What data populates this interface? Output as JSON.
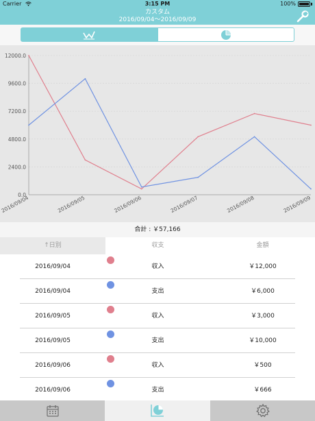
{
  "status_bar": {
    "carrier": "Carrier",
    "time": "3:15 PM",
    "battery": "100%"
  },
  "nav": {
    "title": "カスタム",
    "period": "2016/09/04～2016/09/09"
  },
  "segments": [
    {
      "name": "line-chart",
      "icon": "line-chart-icon",
      "selected": true
    },
    {
      "name": "pie-chart",
      "icon": "pie-chart-icon",
      "selected": false
    }
  ],
  "chart_data": {
    "type": "line",
    "categories": [
      "2016/09/04",
      "2016/09/05",
      "2016/09/06",
      "2016/09/07",
      "2016/09/08",
      "2016/09/09"
    ],
    "series": [
      {
        "values": [
          12000,
          3000,
          500,
          5000,
          7000,
          6000
        ],
        "color": "#e07f8d"
      },
      {
        "values": [
          6000,
          10000,
          666,
          1500,
          5000,
          500
        ],
        "color": "#6f92e2"
      }
    ],
    "y_ticks": [
      "0.0",
      "2400.0",
      "4800.0",
      "7200.0",
      "9600.0",
      "12000.0"
    ],
    "ylim": [
      0,
      12000
    ],
    "grid": true
  },
  "summary": {
    "total_label": "合計 : ￥57,166"
  },
  "table": {
    "headers": {
      "date": "↑日別",
      "type": "収支",
      "amount": "金額"
    },
    "rows": [
      {
        "date": "2016/09/04",
        "type": "収入",
        "amount": "￥12,000",
        "dot": "#e07f8d"
      },
      {
        "date": "2016/09/04",
        "type": "支出",
        "amount": "￥6,000",
        "dot": "#6f92e2"
      },
      {
        "date": "2016/09/05",
        "type": "収入",
        "amount": "￥3,000",
        "dot": "#e07f8d"
      },
      {
        "date": "2016/09/05",
        "type": "支出",
        "amount": "￥10,000",
        "dot": "#6f92e2"
      },
      {
        "date": "2016/09/06",
        "type": "収入",
        "amount": "￥500",
        "dot": "#e07f8d"
      },
      {
        "date": "2016/09/06",
        "type": "支出",
        "amount": "￥666",
        "dot": "#6f92e2"
      }
    ]
  },
  "tabs": [
    {
      "icon": "calendar-icon",
      "selected": false
    },
    {
      "icon": "chart-icon",
      "selected": true
    },
    {
      "icon": "gear-icon",
      "selected": false
    }
  ],
  "colors": {
    "accent": "#7fd0d7",
    "income": "#e07f8d",
    "expense": "#6f92e2"
  }
}
